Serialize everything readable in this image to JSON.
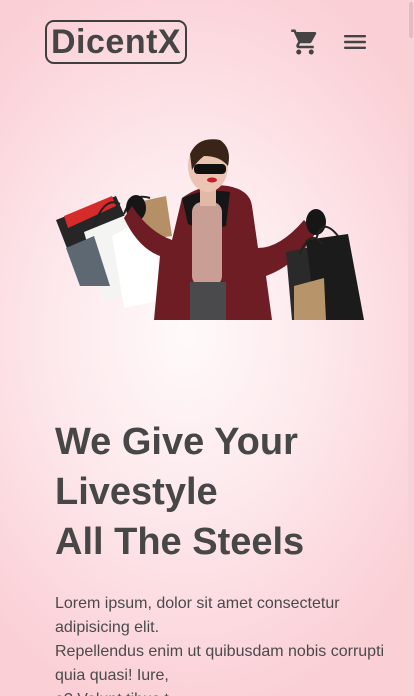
{
  "brand": {
    "logo_text": "DicentX"
  },
  "nav": {
    "cart_icon": "shopping-cart-icon",
    "menu_icon": "hamburger-menu-icon"
  },
  "hero": {
    "image_subject": "woman in sunglasses holding shopping bags",
    "headline_lines": [
      "We Give Your",
      "Livestyle",
      "All The Steels"
    ],
    "body_lines": [
      "Lorem ipsum, dolor sit amet consectetur",
      "adipisicing elit.",
      "Repellendus enim ut quibusdam nobis corrupti",
      "quia quasi! Iure,",
      "a? Volupt tibus t"
    ]
  },
  "colors": {
    "background": "#fbd6dc",
    "text": "#474747",
    "logo_border": "#3f3f3f"
  }
}
